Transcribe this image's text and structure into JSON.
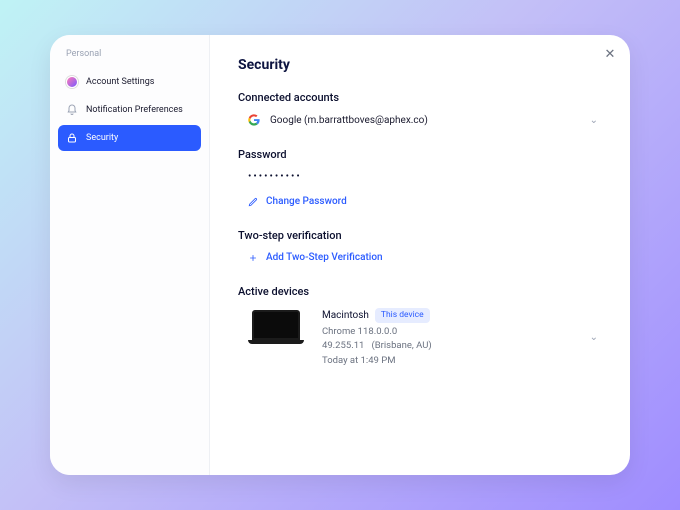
{
  "sidebar": {
    "heading": "Personal",
    "items": [
      {
        "label": "Account Settings",
        "icon": "avatar"
      },
      {
        "label": "Notification Preferences",
        "icon": "bell"
      },
      {
        "label": "Security",
        "icon": "lock",
        "active": true
      }
    ]
  },
  "page": {
    "title": "Security"
  },
  "connected": {
    "title": "Connected accounts",
    "provider": "Google",
    "email": "m.barrattboves@aphex.co",
    "display": "Google (m.barrattboves@aphex.co)"
  },
  "password": {
    "title": "Password",
    "masked": "••••••••••",
    "change_label": "Change Password"
  },
  "twostep": {
    "title": "Two-step verification",
    "add_label": "Add Two-Step Verification"
  },
  "devices": {
    "title": "Active devices",
    "list": [
      {
        "name": "Macintosh",
        "badge": "This device",
        "browser": "Chrome 118.0.0.0",
        "ip": "49.255.11",
        "location": "(Brisbane, AU)",
        "last_seen": "Today at 1:49 PM"
      }
    ]
  }
}
